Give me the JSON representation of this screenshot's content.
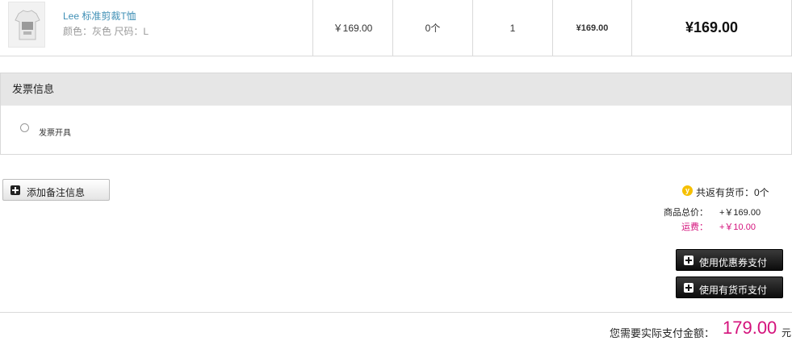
{
  "product": {
    "name": "Lee 标准剪裁T恤",
    "attributes": "颜色：灰色 尺码：L",
    "unit_price": "￥169.00",
    "coins": "0个",
    "quantity": "1",
    "subtotal": "¥169.00",
    "total": "¥169.00"
  },
  "invoice": {
    "title": "发票信息",
    "option_label": "发票开具"
  },
  "note_button_label": "添加备注信息",
  "summary": {
    "coin_icon_glyph": "y",
    "coin_rebate": "共返有货币：0个",
    "goods_total_label": "商品总价：",
    "goods_total_value": "+￥169.00",
    "shipping_label": "运费：",
    "shipping_value": "+￥10.00",
    "coupon_button": "使用优惠券支付",
    "coin_button": "使用有货币支付"
  },
  "payment": {
    "label": "您需要实际支付金额：",
    "amount": "179.00",
    "unit": "元"
  },
  "colors": {
    "accent_pink": "#d4127c",
    "link_blue": "#3f8fb5",
    "coin_yellow": "#f6c000"
  }
}
